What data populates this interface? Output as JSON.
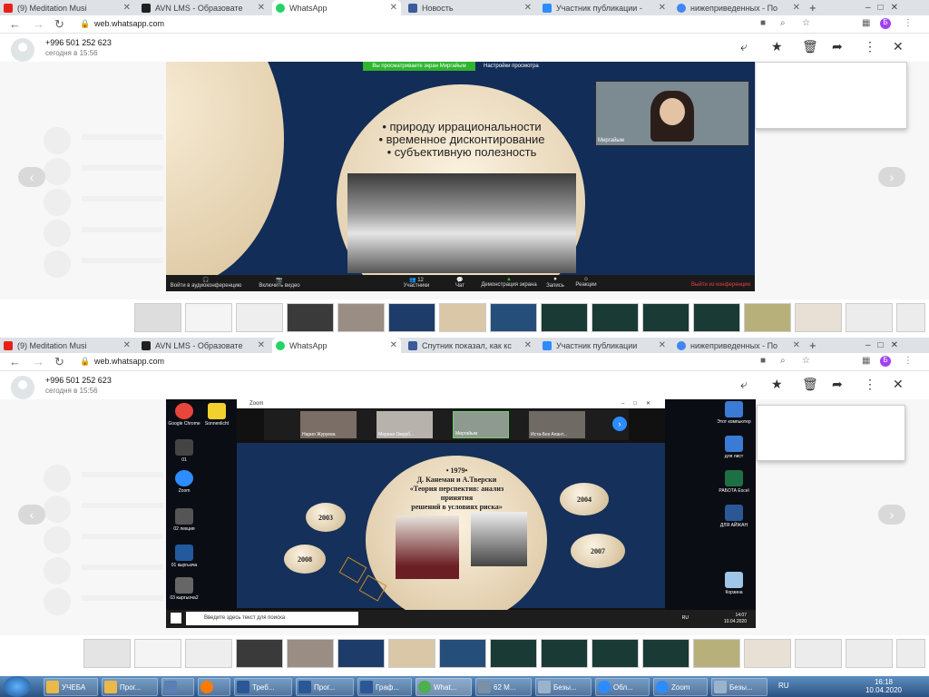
{
  "top": {
    "tabs": [
      {
        "label": "(9) Meditation Musi",
        "color": "#e62117",
        "active": false
      },
      {
        "label": "AVN LMS - Образовате",
        "color": "#202020",
        "active": false
      },
      {
        "label": "WhatsApp",
        "color": "#25d366",
        "active": true
      },
      {
        "label": "Новость",
        "color": "#3b5b9b",
        "active": false
      },
      {
        "label": "Участник публикации -",
        "color": "#2d8cff",
        "active": false
      },
      {
        "label": "нижеприведенных - По",
        "color": "#4285f4",
        "active": false
      }
    ],
    "url": "web.whatsapp.com",
    "phone": "+996 501 252 623",
    "time": "сегодня в 15:56",
    "zoom_banner": "Вы просматриваете экран Миргайым",
    "zoom_settings": "Настройки просмотра",
    "bullets": [
      "• природу иррациональности",
      "• временное дисконтирование",
      "• субъективную полезность"
    ],
    "cam_name": "Миргайым",
    "toolbar": [
      {
        "label": "Войти в аудиоконференцию"
      },
      {
        "label": "Включить видео"
      },
      {
        "label": "Участники"
      },
      {
        "label": "Чат"
      },
      {
        "label": "Демонстрация экрана"
      },
      {
        "label": "Запись"
      },
      {
        "label": "Реакции"
      }
    ],
    "participants_count": "12",
    "leave": "Выйти из конференции"
  },
  "bottom": {
    "tabs": [
      {
        "label": "(9) Meditation Musi",
        "color": "#e62117",
        "active": false
      },
      {
        "label": "AVN LMS - Образовате",
        "color": "#202020",
        "active": false
      },
      {
        "label": "WhatsApp",
        "color": "#25d366",
        "active": true
      },
      {
        "label": "Спутник показал, как кс",
        "color": "#3b5b9b",
        "active": false
      },
      {
        "label": "Участник публикации",
        "color": "#2d8cff",
        "active": false
      },
      {
        "label": "нижеприведенных - По",
        "color": "#4285f4",
        "active": false
      }
    ],
    "url": "web.whatsapp.com",
    "phone": "+996 501 252 623",
    "time": "сегодня в 15:56",
    "zoom_title": "Zoom",
    "participants": [
      "Нарио Журуева",
      "Мерине Омурб...",
      "Миргайым",
      "Иста-Бек Апант..."
    ],
    "slide_title": [
      "• 1979•",
      "Д. Канеман и А.Тверски",
      "«Теория перспектив: анализ",
      "принятия",
      "решений в условиях риска»"
    ],
    "years": [
      "2003",
      "2004",
      "2008",
      "2007"
    ],
    "desktop_left": [
      {
        "label": "Google Chrome",
        "color": "#e8453c"
      },
      {
        "label": "Sonnenlicht",
        "color": "#f2d12e"
      },
      {
        "label": "01",
        "color": "#444"
      },
      {
        "label": "Zoom",
        "color": "#2d8cff"
      },
      {
        "label": "02 лекция",
        "color": "#555"
      },
      {
        "label": "01 кыргызча",
        "color": "#235a9e"
      },
      {
        "label": "03 кыргызча2",
        "color": "#666"
      }
    ],
    "desktop_right": [
      {
        "label": "Этот компьютер",
        "color": "#3a7bd5"
      },
      {
        "label": "для лист",
        "color": "#3a7bd5"
      },
      {
        "label": "РАБОТА Excel",
        "color": "#1d7044"
      },
      {
        "label": "ДЛЯ АЙЖАН",
        "color": "#2b5797"
      },
      {
        "label": "Корзина",
        "color": "#9fc5e8"
      }
    ],
    "search_placeholder": "Введите здесь текст для поиска",
    "mini_clock": {
      "time": "14:07",
      "date": "10.04.2020",
      "lang": "RU"
    }
  },
  "taskbar": {
    "buttons": [
      {
        "label": "УЧЕБА",
        "color": "#e9b949"
      },
      {
        "label": "Прог...",
        "color": "#e9b949"
      },
      {
        "label": "",
        "color": "#5b7fb3"
      },
      {
        "label": "",
        "color": "#ff7a00"
      },
      {
        "label": "Треб...",
        "color": "#2b5797"
      },
      {
        "label": "Прог...",
        "color": "#2b5797"
      },
      {
        "label": "Граф...",
        "color": "#2b5797"
      },
      {
        "label": "What...",
        "color": "#4caf50"
      },
      {
        "label": "62 М...",
        "color": "#7b8fa6"
      },
      {
        "label": "Безы...",
        "color": "#9ab3cc"
      },
      {
        "label": "Обл...",
        "color": "#2d8cff"
      },
      {
        "label": "Zoom",
        "color": "#2d8cff"
      },
      {
        "label": "Безы...",
        "color": "#9ab3cc"
      }
    ],
    "lang": "RU",
    "time": "16:18",
    "date": "10.04.2020"
  }
}
